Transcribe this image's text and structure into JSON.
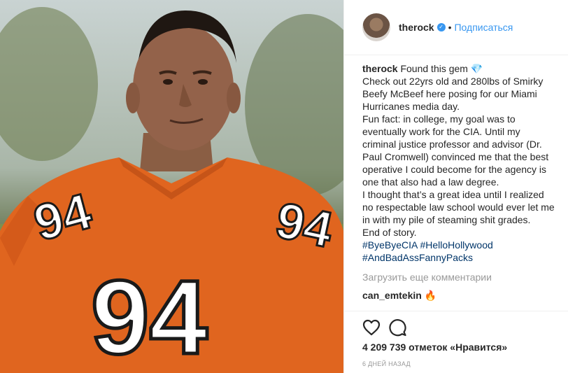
{
  "post": {
    "photo_number": "94",
    "photo_number_right": "94",
    "photo_number_left": "94"
  },
  "header": {
    "username": "therock",
    "verified_icon": "verified-badge-icon",
    "separator": "•",
    "follow_label": "Подписаться"
  },
  "caption": {
    "username": "therock",
    "lines": [
      "Found this gem",
      "Check out 22yrs old and 280lbs of Smirky",
      "Beefy McBeef here posing for our Miami",
      "Hurricanes media day.",
      "Fun fact: in college, my goal was to",
      "eventually work for the CIA. Until my",
      "criminal justice professor and advisor (Dr.",
      "Paul Cromwell) convinced me that the best",
      "operative I could become for the agency is",
      "one that also had a law degree.",
      "I thought that’s a great idea until I realized",
      "no respectable law school would ever let me",
      "in with my pile of steaming shit grades.",
      "End of story."
    ],
    "gem_emoji": "💎",
    "hashtags_line1": "#ByeByeCIA #HelloHollywood",
    "hashtags_line2": "#AndBadAssFannyPacks"
  },
  "comments": {
    "load_more": "Загрузить еще комментарии",
    "first_comment_user": "can_emtekin",
    "first_comment_emoji": "🔥"
  },
  "actions": {
    "likes_text": "4 209 739 отметок «Нравится»",
    "timestamp": "6 ДНЕЙ НАЗАД"
  }
}
